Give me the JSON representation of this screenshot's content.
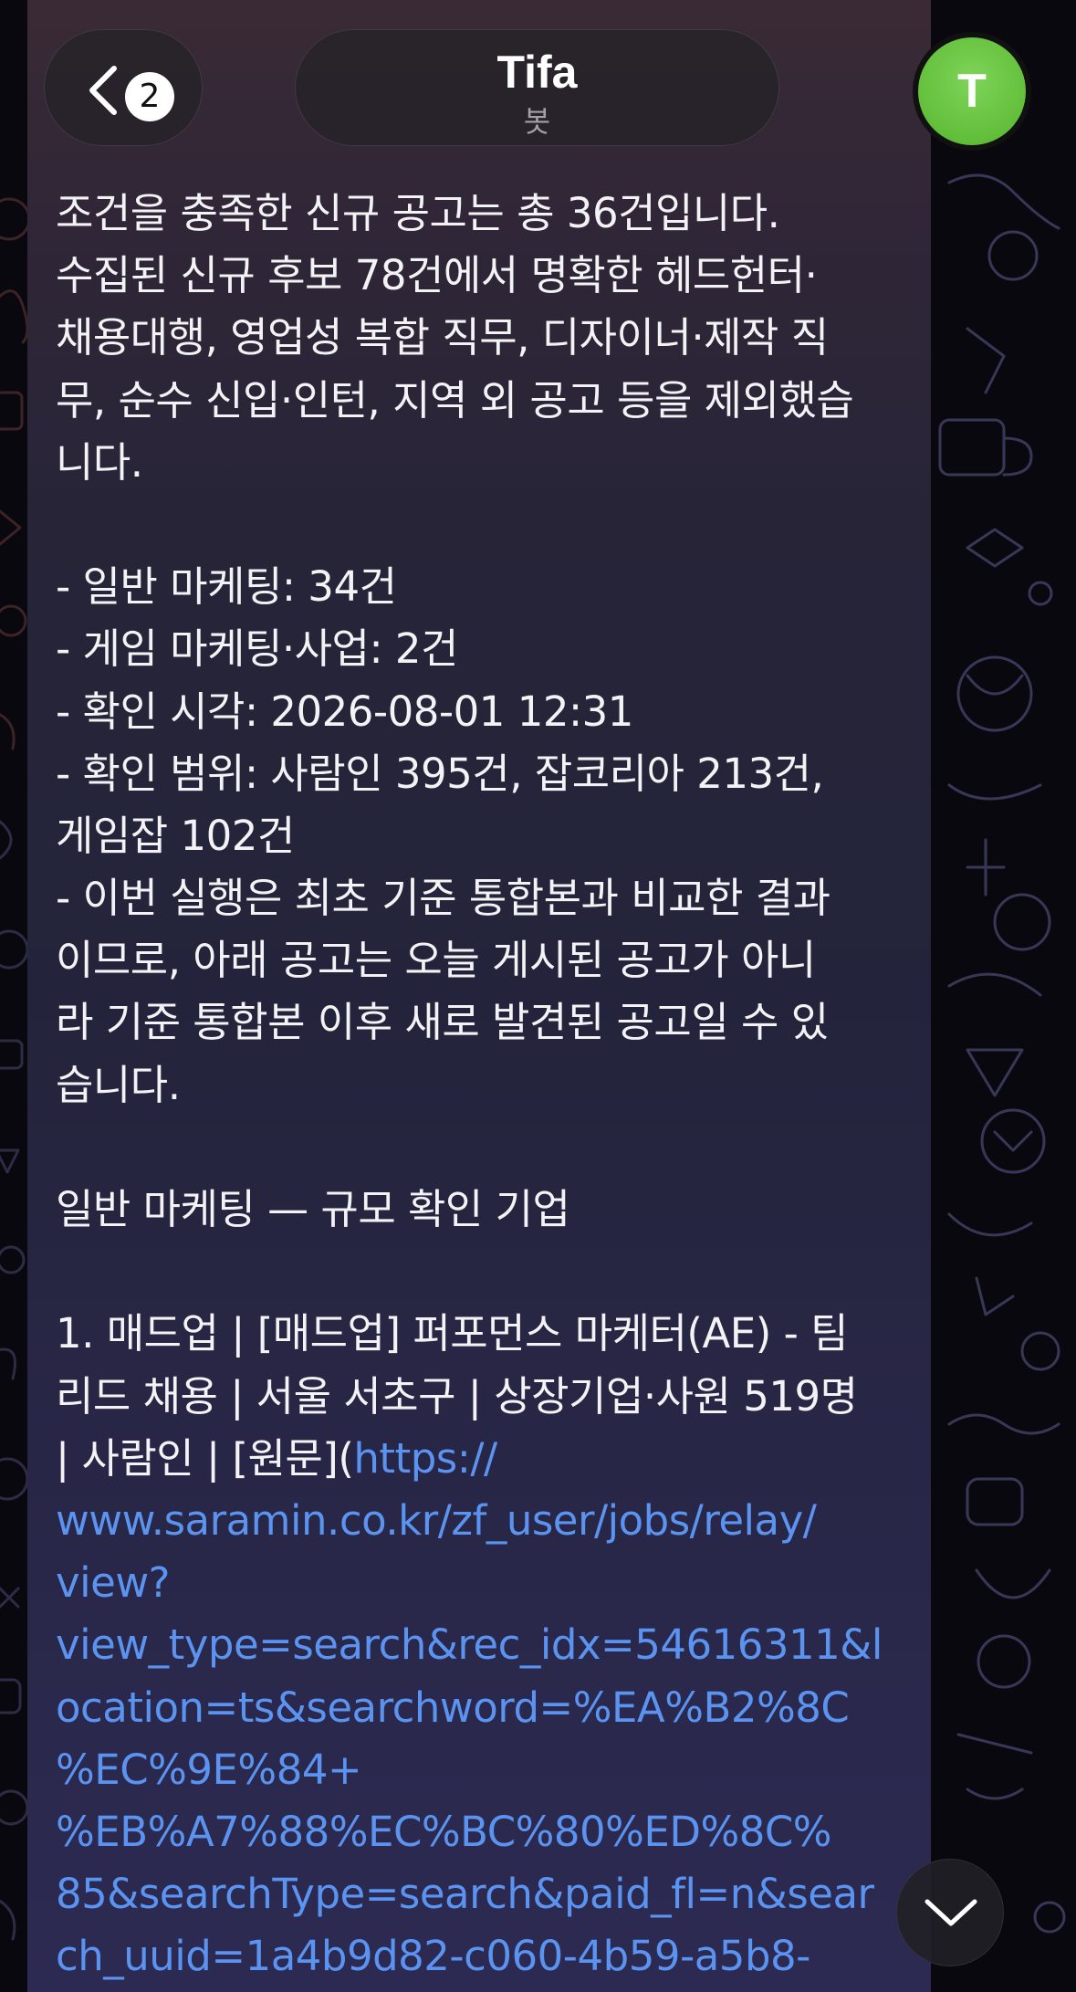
{
  "header": {
    "back_badge_count": "2",
    "chat_title": "Tifa",
    "chat_subtitle": "봇",
    "avatar_letter": "T"
  },
  "colors": {
    "avatar": "#62bf3a",
    "link": "#5b93f0",
    "text": "#f3f3f6"
  },
  "message": {
    "lines": [
      "조건을 충족한 신규 공고는 총 36건입니다.",
      "수집된 신규 후보 78건에서 명확한 헤드헌터·",
      "채용대행, 영업성 복합 직무, 디자이너·제작 직",
      "무, 순수 신입·인턴, 지역 외 공고 등을 제외했습",
      "니다.",
      "",
      "- 일반 마케팅: 34건",
      "- 게임 마케팅·사업: 2건",
      "- 확인 시각: 2026-08-01 12:31",
      "- 확인 범위: 사람인 395건, 잡코리아 213건,",
      "게임잡 102건",
      "- 이번 실행은 최초 기준 통합본과 비교한 결과",
      "이므로, 아래 공고는 오늘 게시된 공고가 아니",
      "라 기준 통합본 이후 새로 발견된 공고일 수 있",
      "습니다.",
      "",
      "일반 마케팅 — 규모 확인 기업",
      "",
      "1. 매드업 | [매드업] 퍼포먼스 마케터(AE) - 팀",
      "리드 채용 | 서울 서초구 | 상장기업·사원 519명"
    ],
    "link_line_prefix": "| 사람인 | [원문](",
    "link_line_url": "https://",
    "link_lines": [
      "www.saramin.co.kr/zf_user/jobs/relay/",
      "view?",
      "view_type=search&rec_idx=54616311&l",
      "ocation=ts&searchword=%EA%B2%8C",
      "%EC%9E%84+",
      "%EB%A7%88%EC%BC%80%ED%8C%",
      "85&searchType=search&paid_fl=n&sear",
      "ch_uuid=1a4b9d82-c060-4b59-a5b8-"
    ]
  }
}
